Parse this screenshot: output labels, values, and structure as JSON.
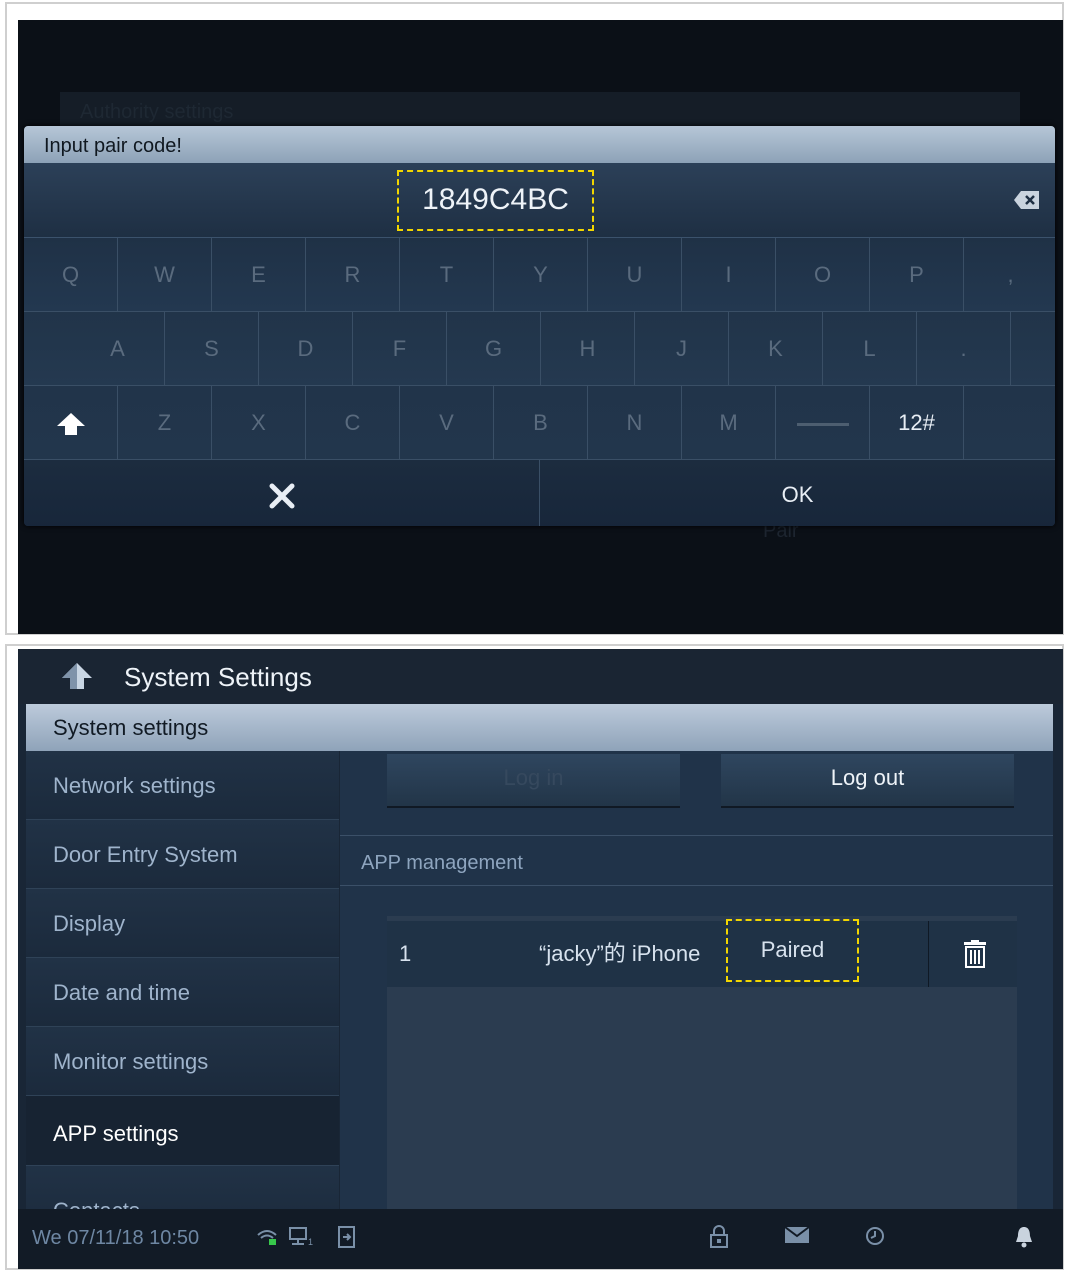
{
  "top_panel": {
    "background": {
      "title": "",
      "row_label": "Authority settings",
      "pair_label": "Pair"
    },
    "dialog": {
      "title": "Input pair code!",
      "input_value": "1849C4BC",
      "keyboard": {
        "row1": [
          "Q",
          "W",
          "E",
          "R",
          "T",
          "Y",
          "U",
          "I",
          "O",
          "P",
          ","
        ],
        "row2": [
          "A",
          "S",
          "D",
          "F",
          "G",
          "H",
          "J",
          "K",
          "L",
          "."
        ],
        "row3": [
          "Z",
          "X",
          "C",
          "V",
          "B",
          "N",
          "M"
        ],
        "symbols_key": "12#"
      },
      "cancel_icon": "close-icon",
      "ok_label": "OK"
    }
  },
  "bottom_panel": {
    "header": {
      "title": "System Settings"
    },
    "section": "System settings",
    "sidebar": {
      "items": [
        {
          "label": "Network settings"
        },
        {
          "label": "Door Entry System"
        },
        {
          "label": "Display"
        },
        {
          "label": "Date and time"
        },
        {
          "label": "Monitor settings"
        },
        {
          "label": "APP settings"
        },
        {
          "label": "Contacts"
        }
      ],
      "active": "APP settings"
    },
    "content": {
      "login_label": "Log in",
      "logout_label": "Log out",
      "app_management_label": "APP management",
      "apps": [
        {
          "index": "1",
          "device": "“jacky”的 iPhone",
          "status": "Paired"
        }
      ]
    },
    "status_bar": {
      "datetime": "We 07/11/18  10:50",
      "icons": [
        "wifi-icon",
        "network-icon",
        "door-icon",
        "lock-icon",
        "mail-icon",
        "history-icon",
        "bell-icon"
      ]
    }
  },
  "colors": {
    "highlight": "#f2d600",
    "header_gradient": "#b6c6d7"
  }
}
